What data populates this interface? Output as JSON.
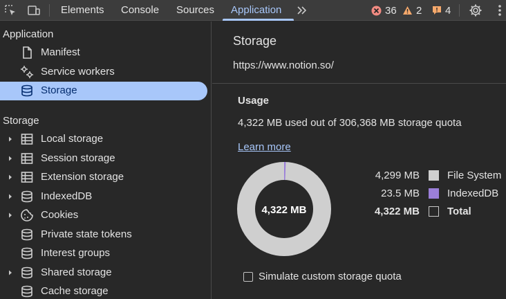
{
  "toolbar": {
    "tabs": [
      "Elements",
      "Console",
      "Sources",
      "Application"
    ],
    "active_tab": "Application",
    "errors": "36",
    "warnings": "2",
    "issues": "4"
  },
  "sidebar": {
    "application_title": "Application",
    "application_items": [
      "Manifest",
      "Service workers",
      "Storage"
    ],
    "storage_title": "Storage",
    "storage_items": [
      "Local storage",
      "Session storage",
      "Extension storage",
      "IndexedDB",
      "Cookies",
      "Private state tokens",
      "Interest groups",
      "Shared storage",
      "Cache storage"
    ]
  },
  "main": {
    "title": "Storage",
    "origin": "https://www.notion.so/",
    "usage_title": "Usage",
    "usage_text": "4,322 MB used out of 306,368 MB storage quota",
    "learn_more": "Learn more",
    "donut_label": "4,322 MB",
    "legend": [
      {
        "value": "4,299 MB",
        "name": "File System",
        "color": "#cfcfcf"
      },
      {
        "value": "23.5 MB",
        "name": "IndexedDB",
        "color": "#9b7fd9"
      },
      {
        "value": "4,322 MB",
        "name": "Total",
        "color": "none"
      }
    ],
    "simulate_label": "Simulate custom storage quota"
  },
  "colors": {
    "accent": "#a8c7fa",
    "error": "#f28b82",
    "warning": "#f6a96c"
  }
}
